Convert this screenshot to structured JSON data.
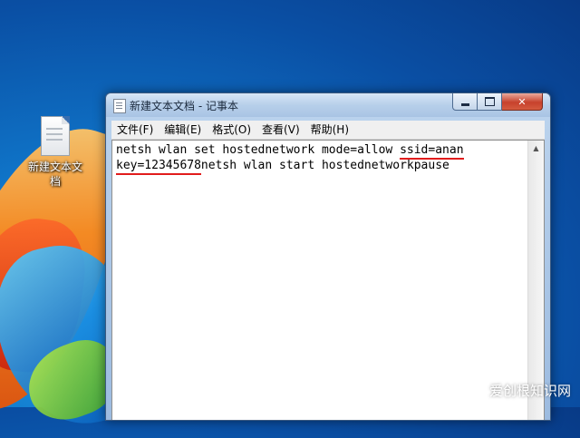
{
  "desktop": {
    "icon_label": "新建文本文档"
  },
  "window": {
    "title": "新建文本文档 - 记事本",
    "close_symbol": "✕"
  },
  "menu": {
    "file": "文件(F)",
    "edit": "编辑(E)",
    "format": "格式(O)",
    "view": "查看(V)",
    "help": "帮助(H)"
  },
  "editor": {
    "line1_prefix": "netsh wlan set hostednetwork mode=allow ",
    "line1_ssid": "ssid=anan",
    "line2_key": "key=12345678",
    "line2_rest": "netsh wlan start hostednetworkpause",
    "highlight_color": "#e11c1c"
  },
  "watermark": "爱创根知识网"
}
